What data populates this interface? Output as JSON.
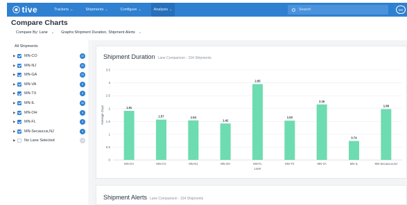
{
  "nav": {
    "logo": "tive",
    "items": [
      {
        "label": "Trackers",
        "active": false
      },
      {
        "label": "Shipments",
        "active": false
      },
      {
        "label": "Configure",
        "active": false
      },
      {
        "label": "Analysis",
        "active": true
      }
    ],
    "search_placeholder": "Search",
    "avatar_initials": "DO"
  },
  "page": {
    "title": "Compare Charts",
    "compare_by": "Compare By: Lane",
    "graphs": "Graphs:Shipment Duration, Shipment Alerts"
  },
  "sidebar": {
    "title": "All Shipments",
    "lanes": [
      {
        "label": "MN-CO",
        "count": "22",
        "checked": true
      },
      {
        "label": "MN-NJ",
        "count": "22",
        "checked": true
      },
      {
        "label": "MN-GA",
        "count": "22",
        "checked": true
      },
      {
        "label": "MN-VA",
        "count": "8",
        "checked": true
      },
      {
        "label": "MN-TX",
        "count": "8",
        "checked": true
      },
      {
        "label": "MN-IL",
        "count": "30",
        "checked": true
      },
      {
        "label": "MN-OH",
        "count": "8",
        "checked": true
      },
      {
        "label": "MN-FL",
        "count": "8",
        "checked": true
      },
      {
        "label": "MN-Secaucus,NJ",
        "count": "8",
        "checked": true
      },
      {
        "label": "No Lane Selected",
        "count": "15",
        "checked": false
      }
    ]
  },
  "charts": {
    "duration": {
      "title": "Shipment Duration",
      "subtitle": "Lane Comparison - 154 Shipments"
    },
    "alerts": {
      "title": "Shipment Alerts",
      "subtitle": "Lane Comparison - 154 Shipments"
    }
  },
  "chart_data": {
    "type": "bar",
    "categories": [
      "MN-GA",
      "MN-CO",
      "MN-NJ",
      "MN-OH",
      "MN-FL",
      "MN-TX",
      "MN-VA",
      "MN-IL",
      "MN-Secaucus,NJ"
    ],
    "values": [
      1.91,
      1.57,
      1.54,
      1.42,
      2.95,
      1.53,
      2.16,
      0.74,
      1.98
    ],
    "value_labels": [
      "1.91",
      "1.57",
      "1.54",
      "1.42",
      "2.95",
      "1.53",
      "2.16",
      "0.74",
      "1.98"
    ],
    "yticks": [
      "0",
      "0.5",
      "1",
      "1.5",
      "2",
      "2.5",
      "3",
      "3.5"
    ],
    "ylim": [
      0,
      3.5
    ],
    "xlabel": "Lane",
    "ylabel": "Average Days",
    "bar_color": "#6edcb1",
    "grid": true
  },
  "colors": {
    "nav": "#2f80d1",
    "accent": "#2f80d1",
    "bar": "#6edcb1"
  }
}
